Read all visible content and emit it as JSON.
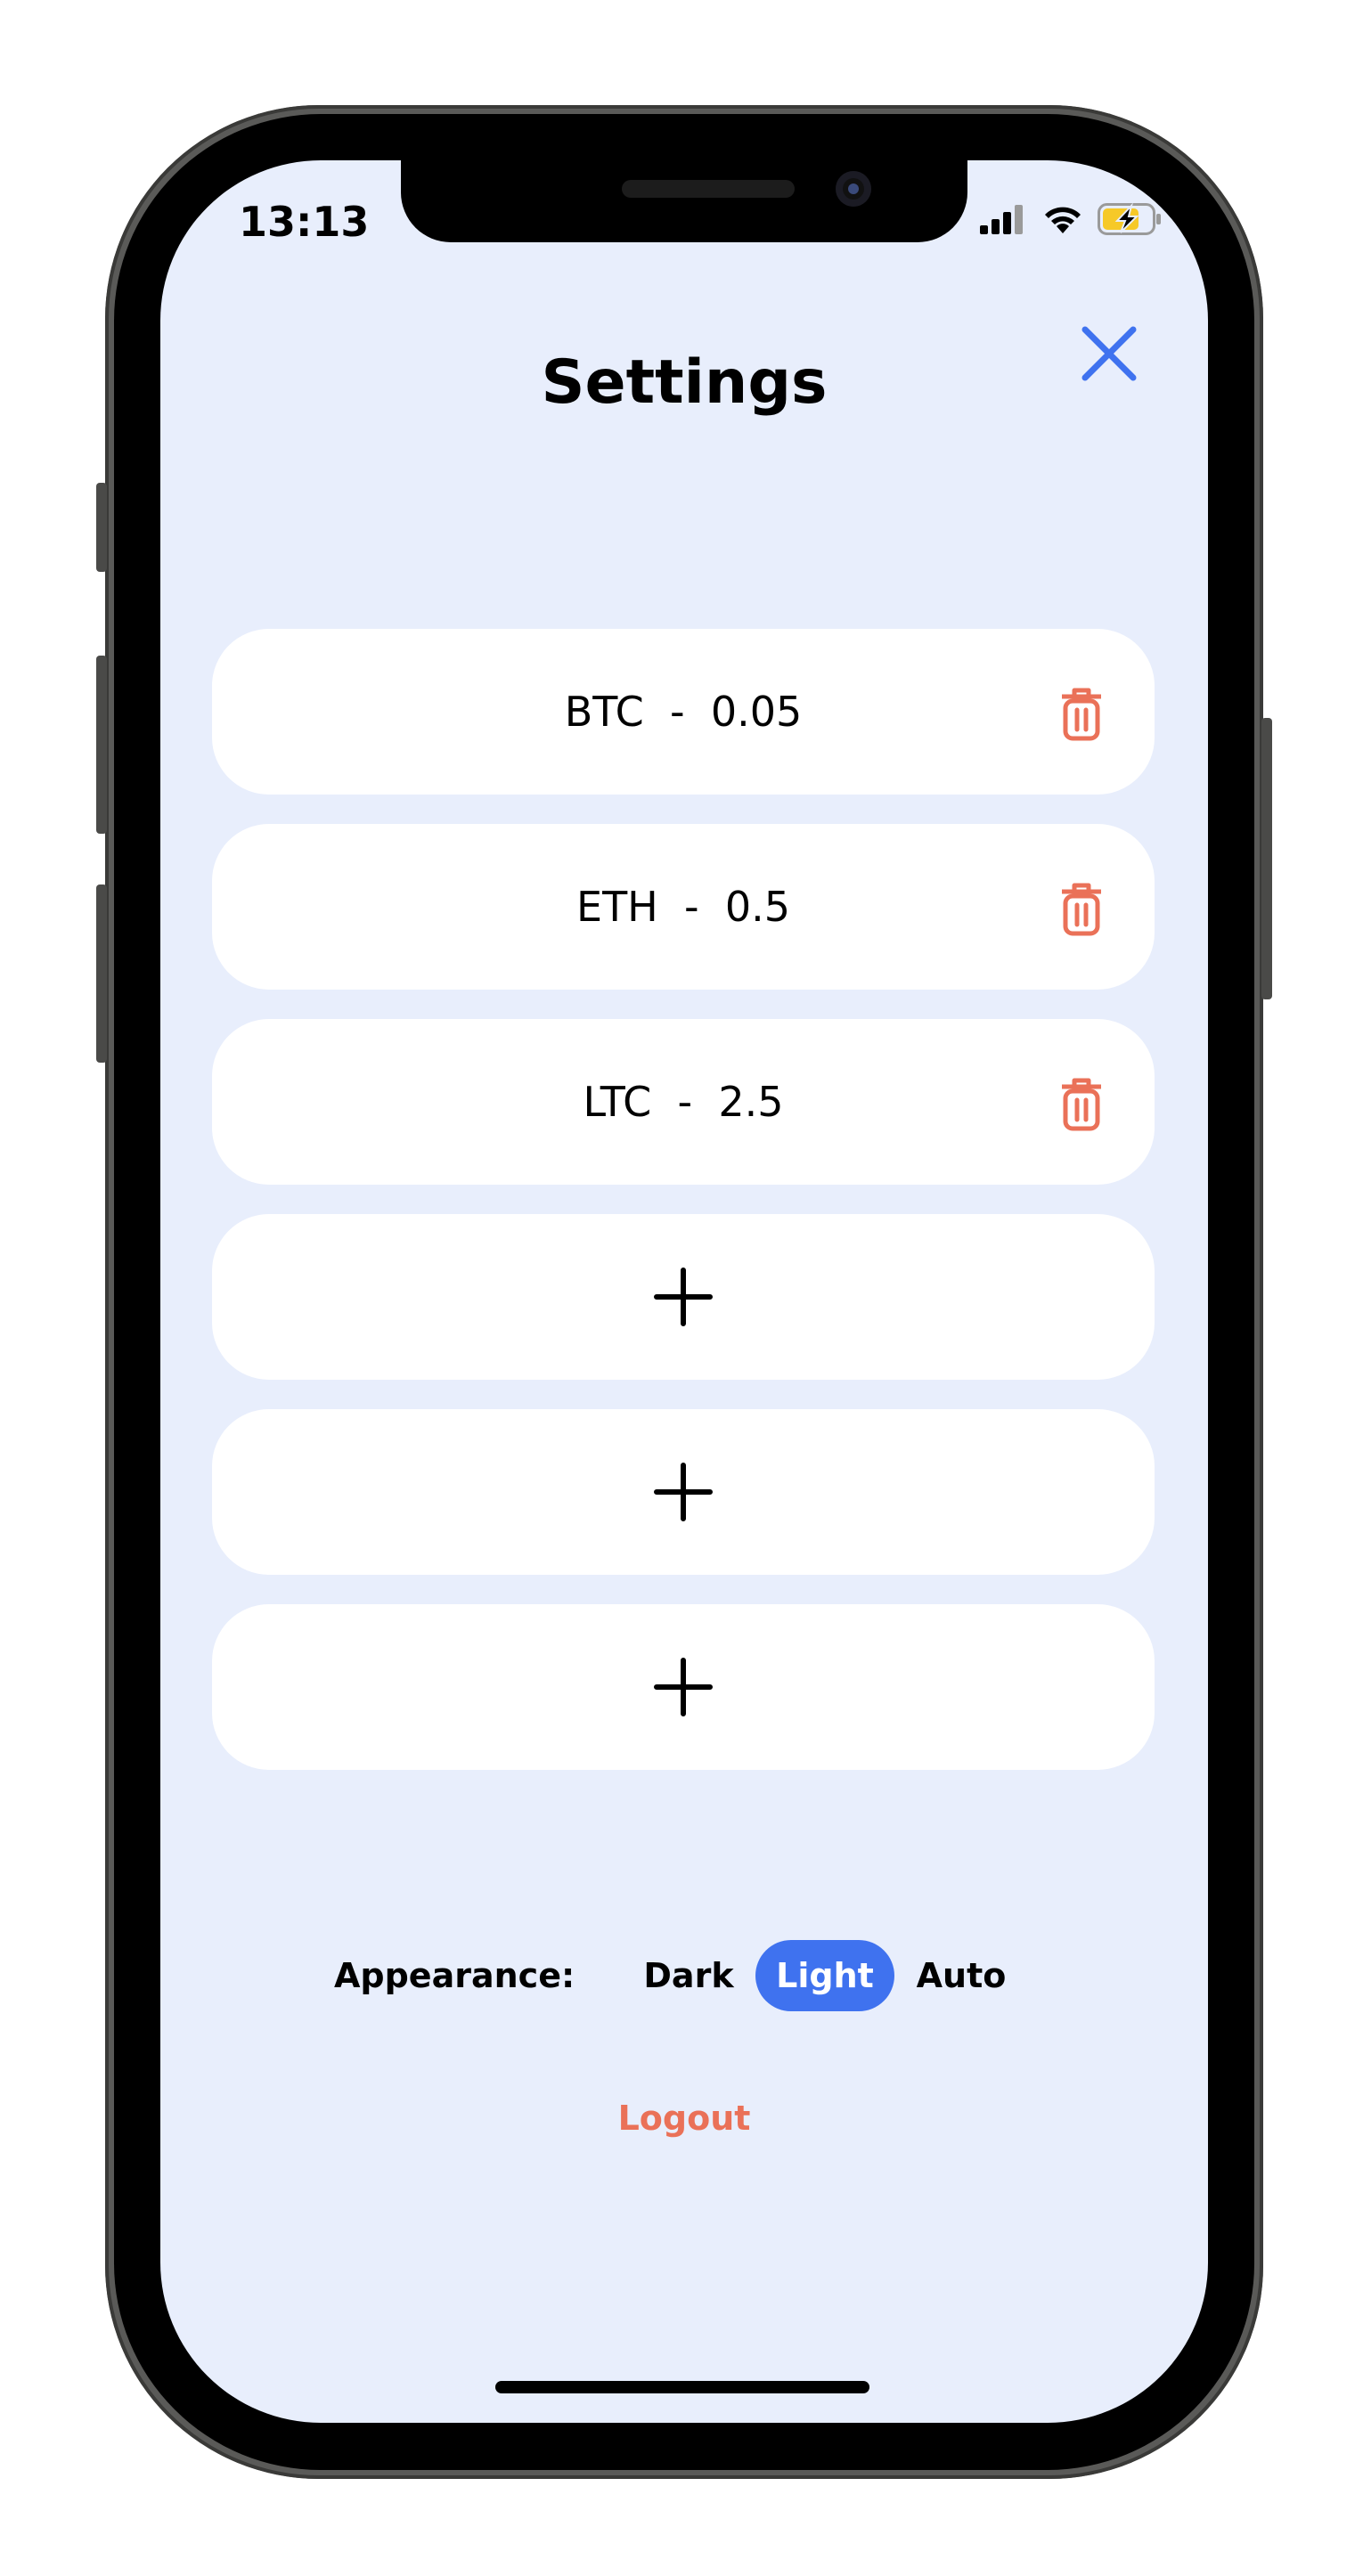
{
  "status_bar": {
    "time": "13:13",
    "icons": [
      "signal-icon",
      "wifi-icon",
      "battery-charging-icon"
    ]
  },
  "header": {
    "title": "Settings",
    "close_icon": "close-icon"
  },
  "holdings": [
    {
      "symbol": "BTC",
      "separator": "-",
      "amount": "0.05",
      "label": "BTC  -  0.05",
      "delete_icon": "trash-icon"
    },
    {
      "symbol": "ETH",
      "separator": "-",
      "amount": "0.5",
      "label": "ETH  -  0.5",
      "delete_icon": "trash-icon"
    },
    {
      "symbol": "LTC",
      "separator": "-",
      "amount": "2.5",
      "label": "LTC  -  2.5",
      "delete_icon": "trash-icon"
    }
  ],
  "empty_slots": [
    {
      "icon": "plus-icon"
    },
    {
      "icon": "plus-icon"
    },
    {
      "icon": "plus-icon"
    }
  ],
  "appearance": {
    "label": "Appearance:",
    "options": [
      "Dark",
      "Light",
      "Auto"
    ],
    "selected": "Light"
  },
  "logout_label": "Logout",
  "colors": {
    "background": "#e8eefc",
    "accent": "#3f72ef",
    "danger": "#ea7158",
    "card": "#ffffff"
  }
}
